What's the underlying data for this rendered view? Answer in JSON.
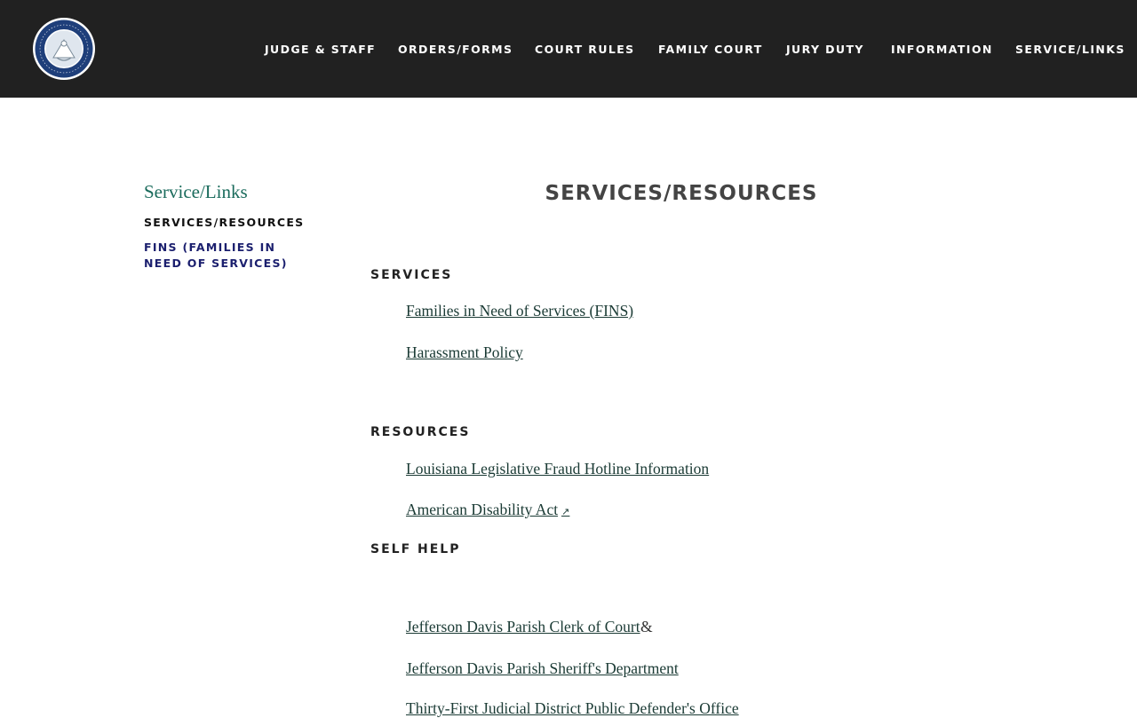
{
  "header": {
    "logo_name": "state-of-louisiana-seal",
    "nav": [
      {
        "label": "JUDGE & STAFF"
      },
      {
        "label": "ORDERS/FORMS"
      },
      {
        "label": "COURT RULES"
      },
      {
        "label": "FAMILY COURT"
      },
      {
        "label": "JURY DUTY"
      },
      {
        "label": "INFORMATION"
      },
      {
        "label": "SERVICE/LINKS"
      }
    ]
  },
  "sidebar": {
    "title": "Service/Links",
    "items": [
      {
        "label": "SERVICES/RESOURCES",
        "current": true
      },
      {
        "label": "FINS (FAMILIES IN NEED OF SERVICES)",
        "current": false
      }
    ]
  },
  "main": {
    "title": "SERVICES/RESOURCES",
    "sections": [
      {
        "heading": "SERVICES",
        "links": [
          {
            "label": "Families in Need of Services (FINS)"
          },
          {
            "label": "Harassment Policy"
          }
        ]
      },
      {
        "heading": "RESOURCES",
        "links": [
          {
            "label": "Louisiana Legislative Fraud Hotline Information"
          },
          {
            "label": "American Disability Act",
            "external_icon": "external-link-icon",
            "external_glyph": "↗"
          }
        ]
      },
      {
        "heading": "SELF HELP",
        "links": [
          {
            "label": "Jefferson Davis Parish Clerk of Court",
            "suffix": "&"
          },
          {
            "label": "Jefferson Davis Parish Sheriff's Department"
          },
          {
            "label": "Thirty-First Judicial District Public Defender's Office"
          }
        ]
      }
    ]
  },
  "colors": {
    "header_bg": "#212121",
    "sidebar_title": "#1a6b5c",
    "sidebar_link": "#1b1f6e",
    "link": "#1a3a34",
    "seal_blue": "#1f3f7a"
  }
}
